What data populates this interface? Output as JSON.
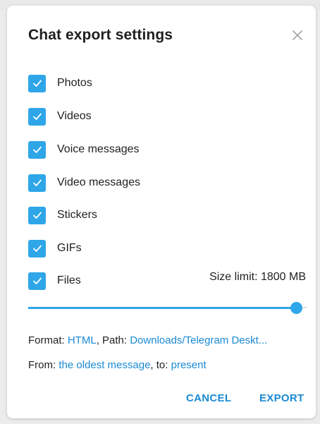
{
  "dialog": {
    "title": "Chat export settings",
    "close_icon": "close-icon",
    "accent_color": "#2ea6e8",
    "link_color": "#1a8ad4"
  },
  "options": [
    {
      "label": "Photos",
      "checked": true
    },
    {
      "label": "Videos",
      "checked": true
    },
    {
      "label": "Voice messages",
      "checked": true
    },
    {
      "label": "Video messages",
      "checked": true
    },
    {
      "label": "Stickers",
      "checked": true
    },
    {
      "label": "GIFs",
      "checked": true
    },
    {
      "label": "Files",
      "checked": true
    }
  ],
  "size_limit": {
    "text": "Size limit: 1800 MB",
    "fraction": 0.96
  },
  "format_line": {
    "format_prefix": "Format: ",
    "format_value": "HTML",
    "path_prefix": ", Path: ",
    "path_value": "Downloads/Telegram Deskt..."
  },
  "range_line": {
    "from_prefix": "From: ",
    "from_value": "the oldest message",
    "to_prefix": ", to: ",
    "to_value": "present"
  },
  "buttons": {
    "cancel": "CANCEL",
    "export": "EXPORT"
  }
}
